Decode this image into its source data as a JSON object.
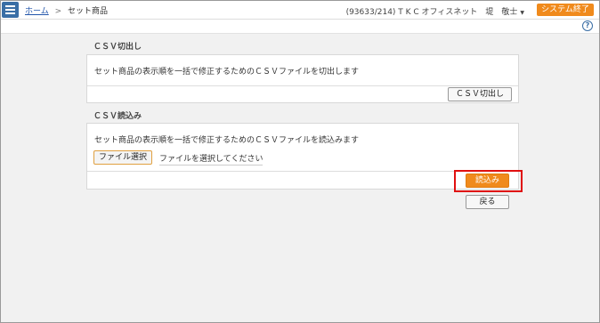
{
  "header": {
    "breadcrumb_home": "ホーム",
    "breadcrumb_sep": ">",
    "breadcrumb_current": "セット商品",
    "user_info": "(93633/214) T K C オフィスネット　堤　敬士",
    "exit_label": "システム終了",
    "help_glyph": "?"
  },
  "export_section": {
    "title": "ＣＳＶ切出し",
    "description": "セット商品の表示順を一括で修正するためのＣＳＶファイルを切出します",
    "button_label": "ＣＳＶ切出し"
  },
  "import_section": {
    "title": "ＣＳＶ読込み",
    "description": "セット商品の表示順を一括で修正するためのＣＳＶファイルを読込みます",
    "file_button_label": "ファイル選択",
    "file_placeholder": "ファイルを選択してください",
    "import_button_label": "読込み"
  },
  "back_label": "戻る",
  "colors": {
    "accent_orange": "#f08a1c",
    "nav_blue": "#3a6ea5",
    "highlight_red": "#e01010"
  }
}
